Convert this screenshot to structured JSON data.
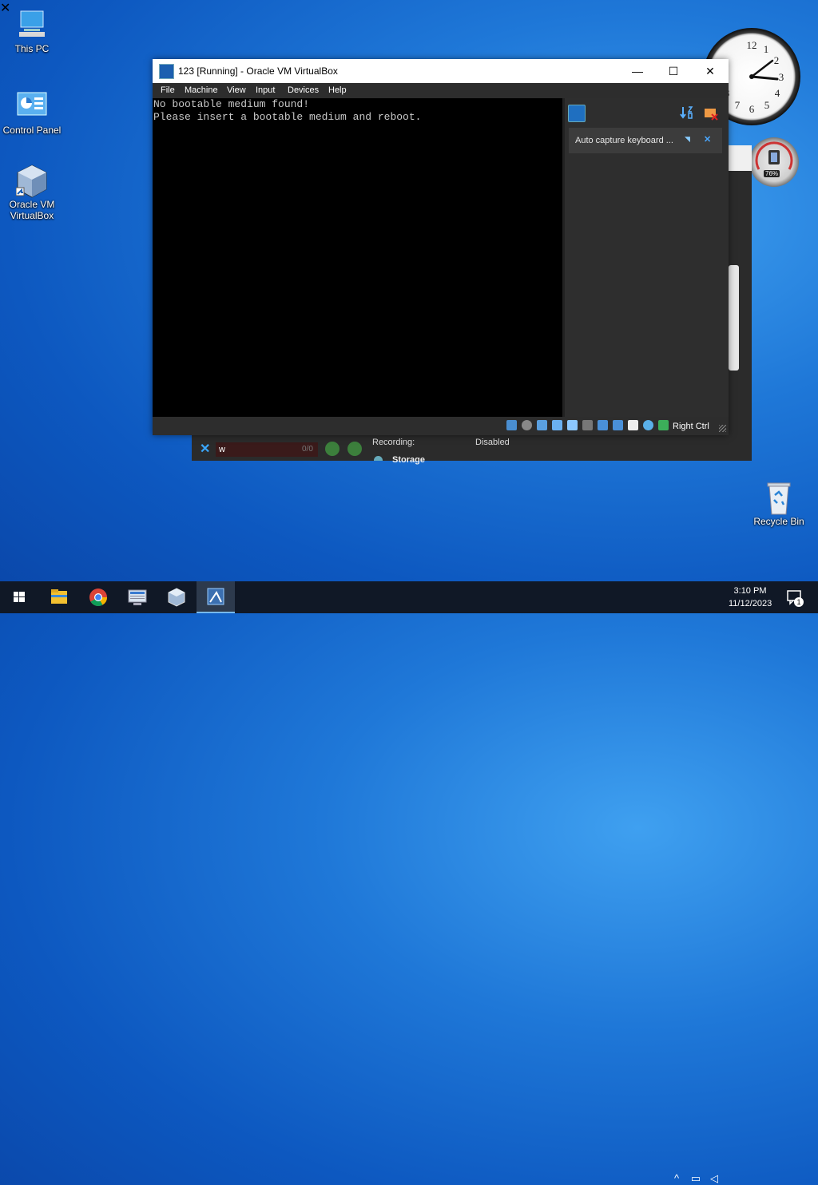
{
  "desktop": {
    "icons": [
      {
        "label": "This PC"
      },
      {
        "label": "Control Panel"
      },
      {
        "label": "Oracle VM\nVirtualBox"
      },
      {
        "label": "Recycle Bin"
      }
    ]
  },
  "gadgets": {
    "meter_percent": "76%"
  },
  "back_window": {
    "search_value": "w",
    "search_count": "0/0",
    "details": [
      {
        "label": "Recording:",
        "value": "Disabled"
      }
    ],
    "storage_heading": "Storage"
  },
  "vm_window": {
    "title": "123 [Running] - Oracle VM VirtualBox",
    "menu": [
      "File",
      "Machine",
      "View",
      "Input",
      "Devices",
      "Help"
    ],
    "screen_lines": [
      "No bootable medium found!",
      "Please insert a bootable medium and reboot."
    ],
    "notification": "Auto capture keyboard ...",
    "host_key": "Right Ctrl"
  },
  "taskbar": {
    "time": "3:10 PM",
    "date": "11/12/2023",
    "notification_count": "1"
  },
  "colors": {
    "accent": "#76b9ed",
    "vm_screen": "#000000"
  }
}
